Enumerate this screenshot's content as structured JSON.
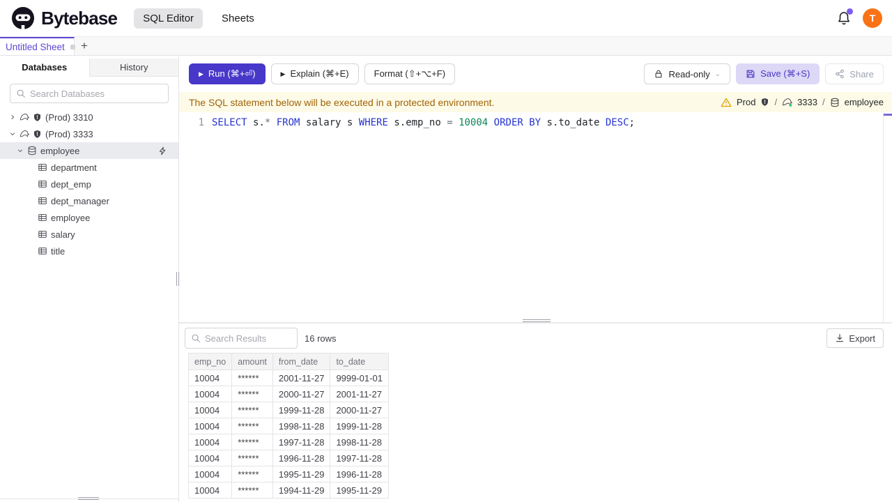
{
  "brand": {
    "name": "Bytebase"
  },
  "header": {
    "nav": [
      {
        "label": "SQL Editor",
        "active": true
      },
      {
        "label": "Sheets",
        "active": false
      }
    ],
    "avatar_text": "T"
  },
  "sheet_tabs": {
    "active_tab": "Untitled Sheet",
    "add_label": "+"
  },
  "sidebar": {
    "tabs": [
      {
        "label": "Databases",
        "active": true
      },
      {
        "label": "History",
        "active": false
      }
    ],
    "search": {
      "placeholder": "Search Databases"
    },
    "tree": [
      {
        "label": "(Prod) 3310",
        "type": "instance",
        "state": "collapsed",
        "selected": false
      },
      {
        "label": "(Prod) 3333",
        "type": "instance",
        "state": "expanded",
        "selected": false
      },
      {
        "label": "employee",
        "type": "database",
        "state": "expanded",
        "selected": true
      },
      {
        "label": "department",
        "type": "table",
        "selected": false
      },
      {
        "label": "dept_emp",
        "type": "table",
        "selected": false
      },
      {
        "label": "dept_manager",
        "type": "table",
        "selected": false
      },
      {
        "label": "employee",
        "type": "table",
        "selected": false
      },
      {
        "label": "salary",
        "type": "table",
        "selected": false
      },
      {
        "label": "title",
        "type": "table",
        "selected": false
      }
    ]
  },
  "toolbar": {
    "run": "Run (⌘+⏎)",
    "explain": "Explain (⌘+E)",
    "format": "Format (⇧+⌥+F)",
    "readonly": "Read-only",
    "save": "Save (⌘+S)",
    "share": "Share"
  },
  "banner": {
    "message": "The SQL statement below will be executed in a protected environment.",
    "environment": "Prod",
    "instance": "3333",
    "database": "employee",
    "separator": "/"
  },
  "editor": {
    "line_number": "1",
    "statement": "SELECT s.* FROM salary s WHERE s.emp_no = 10004 ORDER BY s.to_date DESC;",
    "tokens": [
      {
        "text": "SELECT ",
        "type": "keyword"
      },
      {
        "text": "s.",
        "type": "plain"
      },
      {
        "text": "*",
        "type": "operator"
      },
      {
        "text": " ",
        "type": "plain"
      },
      {
        "text": "FROM ",
        "type": "keyword"
      },
      {
        "text": "salary s ",
        "type": "plain"
      },
      {
        "text": "WHERE ",
        "type": "keyword"
      },
      {
        "text": "s.emp_no ",
        "type": "plain"
      },
      {
        "text": "= ",
        "type": "operator"
      },
      {
        "text": "10004",
        "type": "number"
      },
      {
        "text": " ",
        "type": "plain"
      },
      {
        "text": "ORDER BY ",
        "type": "keyword"
      },
      {
        "text": "s.to_date ",
        "type": "plain"
      },
      {
        "text": "DESC",
        "type": "keyword"
      },
      {
        "text": ";",
        "type": "plain"
      }
    ]
  },
  "results": {
    "search": {
      "placeholder": "Search Results"
    },
    "row_count": "16 rows",
    "export_label": "Export",
    "table": {
      "columns": [
        "emp_no",
        "amount",
        "from_date",
        "to_date"
      ],
      "rows": [
        [
          "10004",
          "******",
          "2001-11-27",
          "9999-01-01"
        ],
        [
          "10004",
          "******",
          "2000-11-27",
          "2001-11-27"
        ],
        [
          "10004",
          "******",
          "1999-11-28",
          "2000-11-27"
        ],
        [
          "10004",
          "******",
          "1998-11-28",
          "1999-11-28"
        ],
        [
          "10004",
          "******",
          "1997-11-28",
          "1998-11-28"
        ],
        [
          "10004",
          "******",
          "1996-11-28",
          "1997-11-28"
        ],
        [
          "10004",
          "******",
          "1995-11-29",
          "1996-11-28"
        ],
        [
          "10004",
          "******",
          "1994-11-29",
          "1995-11-29"
        ]
      ]
    }
  },
  "colors": {
    "accent_purple": "#4738c9",
    "banner_bg": "#fdfbe7",
    "banner_text": "#a16207",
    "avatar_orange": "#f97316",
    "sql_keyword": "#2533d0",
    "sql_number": "#098658"
  }
}
